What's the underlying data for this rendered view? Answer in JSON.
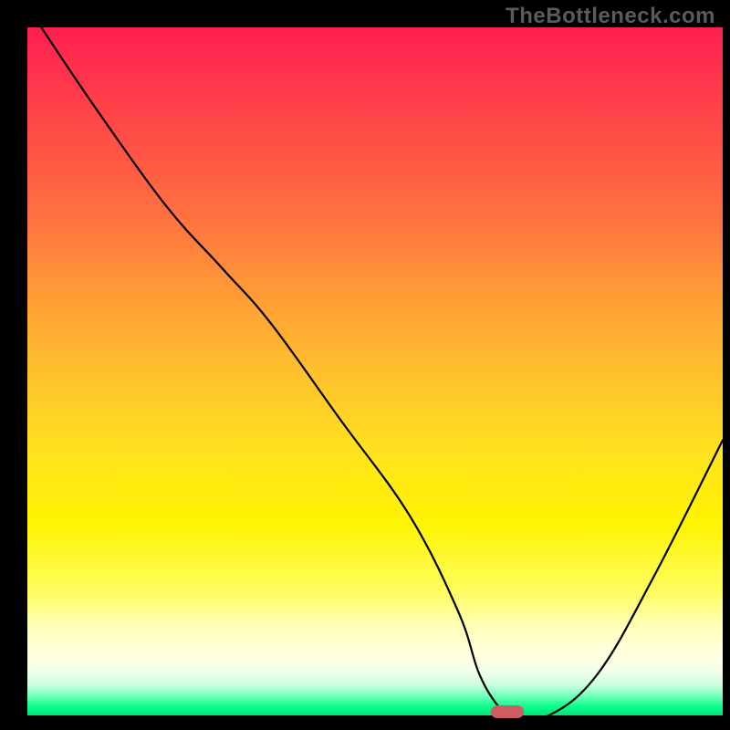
{
  "watermark": "TheBottleneck.com",
  "chart_data": {
    "type": "line",
    "title": "",
    "xlabel": "",
    "ylabel": "",
    "xlim": [
      0,
      100
    ],
    "ylim": [
      0,
      100
    ],
    "grid": false,
    "legend": false,
    "series": [
      {
        "name": "curve",
        "x": [
          2,
          10,
          20,
          28,
          35,
          45,
          55,
          62,
          65,
          68,
          70,
          75,
          82,
          90,
          100
        ],
        "y": [
          100,
          88,
          74,
          65,
          57,
          43,
          29,
          15,
          6,
          1,
          0,
          0,
          6,
          20,
          40
        ]
      }
    ],
    "marker": {
      "x": 69,
      "y": 0.5,
      "color": "#cd5d63"
    },
    "gradient_description": "vertical red-to-green (top=red=bad, bottom=green=good)"
  }
}
